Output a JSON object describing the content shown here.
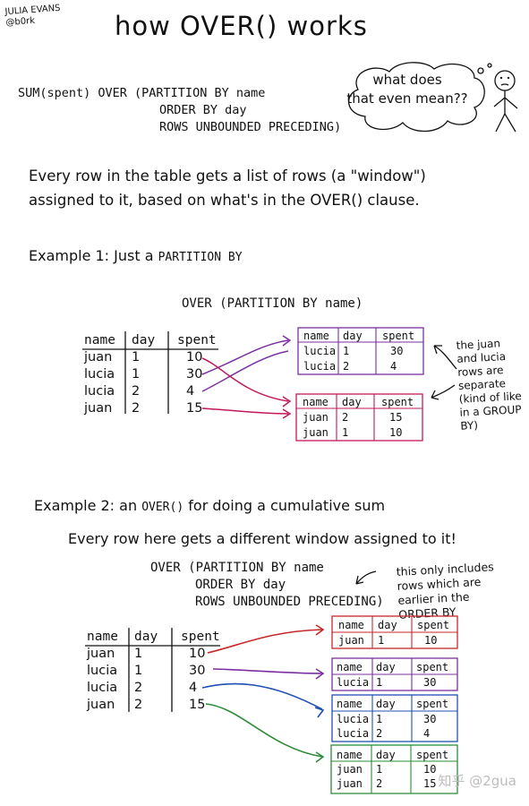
{
  "header": {
    "author": "JULIA EVANS\n@b0rk",
    "title": "how OVER() works"
  },
  "top_query": {
    "lines": [
      "SUM(spent) OVER (PARTITION BY name",
      "ORDER BY day",
      "ROWS UNBOUNDED PRECEDING)"
    ]
  },
  "speech_bubble": {
    "text": "what does\nthat even mean??"
  },
  "intro": {
    "text": "Every row in the table gets a list of rows (a \"window\")\nassigned to it, based on what's in the OVER() clause."
  },
  "example1": {
    "heading": "Example 1: Just a",
    "heading_code": "PARTITION BY",
    "clause": "OVER (PARTITION BY name)",
    "table": {
      "headers": [
        "name",
        "day",
        "spent"
      ],
      "rows": [
        [
          "juan",
          "1",
          "10"
        ],
        [
          "lucia",
          "1",
          "30"
        ],
        [
          "lucia",
          "2",
          "4"
        ],
        [
          "juan",
          "2",
          "15"
        ]
      ]
    },
    "box_lucia": {
      "headers": [
        "name",
        "day",
        "spent"
      ],
      "rows": [
        [
          "lucia",
          "1",
          "30"
        ],
        [
          "lucia",
          "2",
          "4"
        ]
      ]
    },
    "box_juan": {
      "headers": [
        "name",
        "day",
        "spent"
      ],
      "rows": [
        [
          "juan",
          "2",
          "15"
        ],
        [
          "juan",
          "1",
          "10"
        ]
      ]
    },
    "note": "the juan\nand lucia\nrows are\nseparate\n(kind of like\nin a GROUP\nBY)"
  },
  "example2": {
    "heading": "Example 2: an",
    "heading_code": "OVER()",
    "heading_rest": "for doing a cumulative sum",
    "subheading": "Every row here gets a different window assigned to it!",
    "clause_lines": [
      "OVER (PARTITION BY name",
      "ORDER BY day",
      "ROWS UNBOUNDED PRECEDING)"
    ],
    "note": "this only includes\nrows which are\nearlier in the\nORDER BY",
    "table": {
      "headers": [
        "name",
        "day",
        "spent"
      ],
      "rows": [
        [
          "juan",
          "1",
          "10"
        ],
        [
          "lucia",
          "1",
          "30"
        ],
        [
          "lucia",
          "2",
          "4"
        ],
        [
          "juan",
          "2",
          "15"
        ]
      ]
    },
    "boxes": [
      {
        "headers": [
          "name",
          "day",
          "spent"
        ],
        "rows": [
          [
            "juan",
            "1",
            "10"
          ]
        ]
      },
      {
        "headers": [
          "name",
          "day",
          "spent"
        ],
        "rows": [
          [
            "lucia",
            "1",
            "30"
          ]
        ]
      },
      {
        "headers": [
          "name",
          "day",
          "spent"
        ],
        "rows": [
          [
            "lucia",
            "1",
            "30"
          ],
          [
            "lucia",
            "2",
            "4"
          ]
        ]
      },
      {
        "headers": [
          "name",
          "day",
          "spent"
        ],
        "rows": [
          [
            "juan",
            "1",
            "10"
          ],
          [
            "juan",
            "2",
            "15"
          ]
        ]
      }
    ]
  },
  "colors": {
    "pink": "#c2185b",
    "purple": "#7b2fa0",
    "red": "#c62828",
    "blue": "#1f4fb4",
    "green": "#2e8b3a"
  },
  "watermark": "知乎 @2gua"
}
